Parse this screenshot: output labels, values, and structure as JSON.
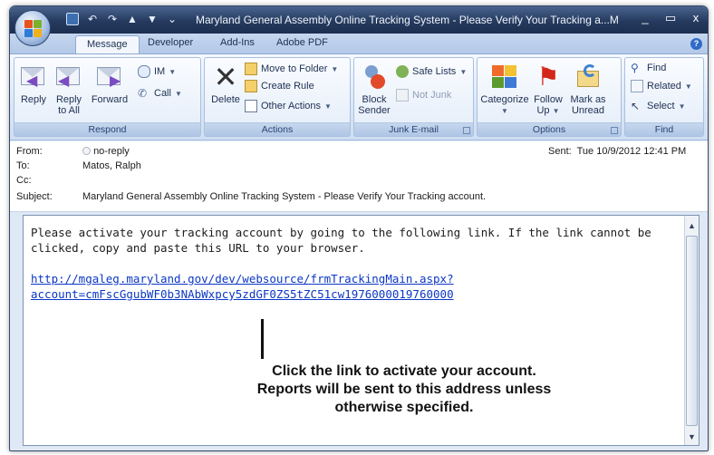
{
  "window": {
    "title": "Maryland General Assembly Online Tracking System - Please Verify Your Tracking a...M",
    "controls": [
      "_",
      "▭",
      "x"
    ]
  },
  "tabs": [
    "Message",
    "Developer",
    "Add-Ins",
    "Adobe PDF"
  ],
  "ribbon": {
    "respond": {
      "label": "Respond",
      "reply": "Reply",
      "reply_all_1": "Reply",
      "reply_all_2": "to All",
      "forward": "Forward",
      "im": "IM",
      "call": "Call"
    },
    "actions": {
      "label": "Actions",
      "delete": "Delete",
      "move_to_folder": "Move to Folder",
      "create_rule": "Create Rule",
      "other_actions": "Other Actions"
    },
    "junk": {
      "label": "Junk E-mail",
      "block_1": "Block",
      "block_2": "Sender",
      "safe_lists": "Safe Lists",
      "not_junk": "Not Junk"
    },
    "options": {
      "label": "Options",
      "categorize": "Categorize",
      "follow_up_1": "Follow",
      "follow_up_2": "Up",
      "mark_unread_1": "Mark as",
      "mark_unread_2": "Unread"
    },
    "find": {
      "label": "Find",
      "find": "Find",
      "related": "Related",
      "select": "Select"
    }
  },
  "headers": {
    "from_label": "From:",
    "from_value": "no-reply",
    "to_label": "To:",
    "to_value": "Matos, Ralph",
    "cc_label": "Cc:",
    "cc_value": "",
    "subject_label": "Subject:",
    "subject_value": "Maryland General Assembly Online Tracking System - Please Verify Your Tracking account.",
    "sent_label": "Sent:",
    "sent_value": "Tue 10/9/2012 12:41 PM"
  },
  "message": {
    "paragraph": "Please activate your tracking account by going to the following link. If the link cannot be clicked, copy and paste this URL to your browser.",
    "link_line1": "http://mgaleg.maryland.gov/dev/websource/frmTrackingMain.aspx?",
    "link_line2": "account=cmFscGgubWF0b3NAbWxpcy5zdGF0ZS5tZC51cw1976000019760000"
  },
  "annotation": {
    "line1": "Click the link to activate your account.",
    "line2": "Reports will be sent to this address unless",
    "line3": "otherwise specified."
  },
  "colors": {
    "link": "#0b37c4",
    "title_bar": "#253a5e",
    "ribbon_label": "#afc6e5"
  }
}
